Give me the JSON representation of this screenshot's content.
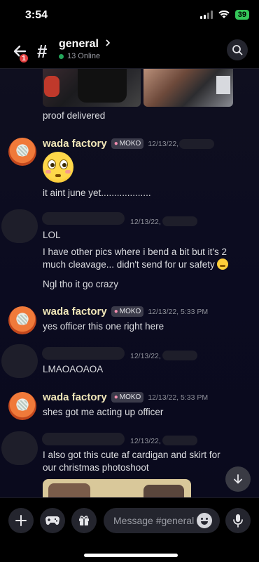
{
  "status": {
    "time": "3:54",
    "battery": "39"
  },
  "header": {
    "notification_count": "1",
    "channel_name": "general",
    "online_count": "13 Online"
  },
  "messages": {
    "m0_text": "proof delivered",
    "m1": {
      "author": "wada factory",
      "role": "MOKO",
      "timestamp": "12/13/22,",
      "text": "it aint june yet..................."
    },
    "m2": {
      "timestamp": "12/13/22,",
      "text1": "LOL",
      "text2": "I have other pics where i bend a bit but it's 2 much cleavage... didn't send for ur safety",
      "text3": "Ngl tho it go crazy"
    },
    "m3": {
      "author": "wada factory",
      "role": "MOKO",
      "timestamp": "12/13/22, 5:33 PM",
      "text": "yes officer this one right here"
    },
    "m4": {
      "timestamp": "12/13/22,",
      "text": "LMAOAOAOA"
    },
    "m5": {
      "author": "wada factory",
      "role": "MOKO",
      "timestamp": "12/13/22, 5:33 PM",
      "text": "shes got me acting up officer"
    },
    "m6": {
      "timestamp": "12/13/22,",
      "text": "I also got this cute af cardigan and skirt for our christmas photoshoot"
    }
  },
  "composer": {
    "placeholder": "Message #general"
  },
  "icons": [
    "back-arrow-icon",
    "search-icon",
    "plus-icon",
    "gamepad-icon",
    "gift-icon",
    "emoji-icon",
    "microphone-icon",
    "chevron-down-icon"
  ]
}
